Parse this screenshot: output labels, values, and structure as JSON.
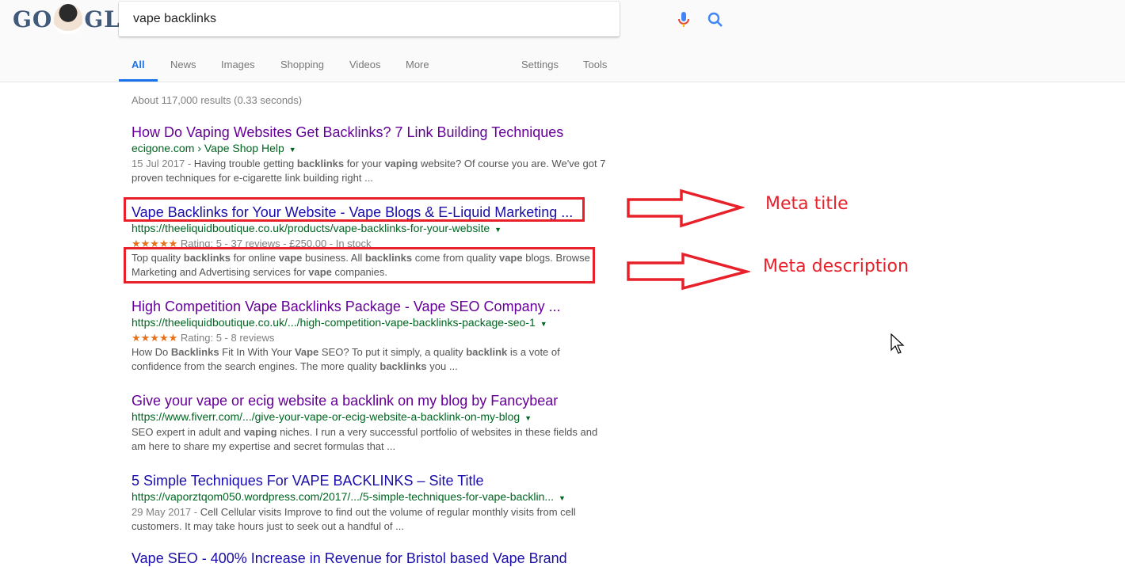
{
  "logo": {
    "left": "GO",
    "right": "GLE"
  },
  "search": {
    "query": "vape backlinks",
    "mic_icon": "mic-icon",
    "search_icon": "magnifier-icon"
  },
  "tabs": [
    {
      "label": "All",
      "active": true
    },
    {
      "label": "News"
    },
    {
      "label": "Images"
    },
    {
      "label": "Shopping"
    },
    {
      "label": "Videos"
    },
    {
      "label": "More"
    },
    {
      "label": "Settings"
    },
    {
      "label": "Tools"
    }
  ],
  "stats": "About 117,000 results (0.33 seconds)",
  "results": [
    {
      "title": "How Do Vaping Websites Get Backlinks? 7 Link Building Techniques",
      "url": "ecigone.com › Vape Shop Help",
      "date": "15 Jul 2017 - ",
      "snippet_html": "Having trouble getting <b>backlinks</b> for your <b>vaping</b> website? Of course you are. We've got 7 proven techniques for e-cigarette link building right ..."
    },
    {
      "title": "Vape Backlinks for Your Website - Vape Blogs & E-Liquid Marketing ...",
      "url": "https://theeliquidboutique.co.uk/products/vape-backlinks-for-your-website",
      "stars": "★★★★★",
      "rating": "Rating: 5 - 37 reviews - £250.00 - In stock",
      "snippet_html": "Top quality <b>backlinks</b> for online <b>vape</b> business. All <b>backlinks</b> come from quality <b>vape</b> blogs. Browse Marketing and Advertising services for <b>vape</b> companies."
    },
    {
      "title": "High Competition Vape Backlinks Package - Vape SEO Company ...",
      "url": "https://theeliquidboutique.co.uk/.../high-competition-vape-backlinks-package-seo-1",
      "stars": "★★★★★",
      "rating": "Rating: 5 - 8 reviews",
      "snippet_html": "How Do <b>Backlinks</b> Fit In With Your <b>Vape</b> SEO? To put it simply, a quality <b>backlink</b> is a vote of confidence from the search engines. The more quality <b>backlinks</b> you ..."
    },
    {
      "title": "Give your vape or ecig website a backlink on my blog by Fancybear",
      "url": "https://www.fiverr.com/.../give-your-vape-or-ecig-website-a-backlink-on-my-blog",
      "snippet_html": "SEO expert in adult and <b>vaping</b> niches. I run a very successful portfolio of websites in these fields and am here to share my expertise and secret formulas that ..."
    },
    {
      "title": "5 Simple Techniques For VAPE BACKLINKS – Site Title",
      "url": "https://vaporztqom050.wordpress.com/2017/.../5-simple-techniques-for-vape-backlin...",
      "date": "29 May 2017 - ",
      "snippet_html": "Cell Cellular visits Improve to find out the volume of regular monthly visits from cell customers. It may take hours just to seek out a handful of ..."
    },
    {
      "title": "Vape SEO - 400% Increase in Revenue for Bristol based Vape Brand"
    }
  ],
  "annotations": {
    "meta_title": "Meta title",
    "meta_description": "Meta description",
    "color": "#e8202a"
  }
}
